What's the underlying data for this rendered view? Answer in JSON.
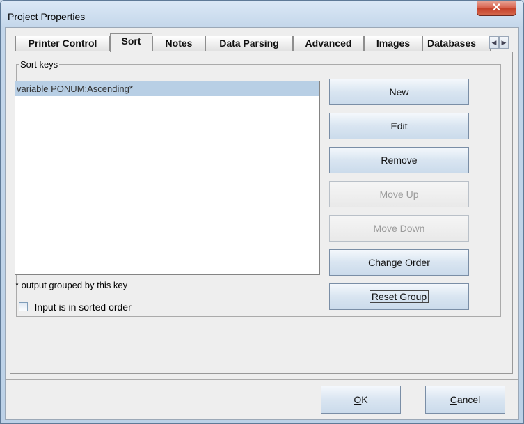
{
  "window": {
    "title": "Project Properties",
    "close_glyph": "✕"
  },
  "tabs": [
    {
      "label": "Printer Control"
    },
    {
      "label": "Sort",
      "active": true
    },
    {
      "label": "Notes"
    },
    {
      "label": "Data Parsing"
    },
    {
      "label": "Advanced"
    },
    {
      "label": "Images"
    },
    {
      "label": "Databases"
    }
  ],
  "tab_scroll": {
    "left_glyph": "◀",
    "right_glyph": "▶"
  },
  "sort_panel": {
    "group_label": "Sort keys",
    "keys": [
      "variable PONUM;Ascending*"
    ],
    "buttons": {
      "new": "New",
      "edit": "Edit",
      "remove": "Remove",
      "move_up": "Move Up",
      "move_down": "Move Down",
      "change_order": "Change Order",
      "reset_group": "Reset Group"
    },
    "note": "* output grouped by this key",
    "sorted_checkbox": {
      "label": "Input is in sorted order",
      "checked": false
    }
  },
  "footer": {
    "ok_mnemonic": "O",
    "ok_rest": "K",
    "cancel_mnemonic": "C",
    "cancel_rest": "ancel"
  },
  "colors": {
    "selection": "#b8cfe5",
    "close_button": "#c33f28"
  }
}
